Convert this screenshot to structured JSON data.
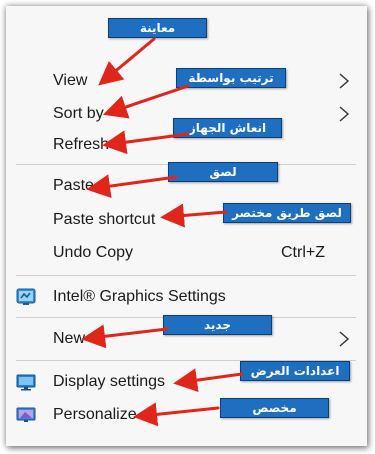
{
  "menu": {
    "view": "View",
    "sort_by": "Sort by",
    "refresh": "Refresh",
    "paste": "Paste",
    "paste_shortcut": "Paste shortcut",
    "undo_copy": "Undo Copy",
    "undo_copy_shortcut": "Ctrl+Z",
    "intel_graphics": "Intel® Graphics Settings",
    "new": "New",
    "display_settings": "Display settings",
    "personalize": "Personalize"
  },
  "annotations": {
    "view": "معاينة",
    "sort_by": "ترتيب بواسطة",
    "refresh": "انعاش الجهاز",
    "paste": "لصق",
    "paste_shortcut": "لصق طريق مختصر",
    "new": "جديد",
    "display_settings": "اعدادات العرض",
    "personalize": "مخصص"
  },
  "colors": {
    "callout_bg": "#1f6fc1",
    "arrow": "#e0251b",
    "menu_bg": "#f7f7f7"
  },
  "icons": [
    "chevron-right-icon",
    "intel-graphics-icon",
    "display-settings-icon",
    "personalize-icon"
  ]
}
